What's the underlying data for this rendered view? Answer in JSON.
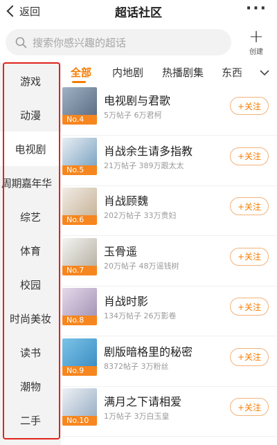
{
  "header": {
    "back_label": "返回",
    "title": "超话社区",
    "more_label": "···"
  },
  "search": {
    "placeholder": "搜索你感兴趣的超话",
    "create_label": "创建"
  },
  "sidebar": {
    "items": [
      {
        "label": "游戏"
      },
      {
        "label": "动漫"
      },
      {
        "label": "电视剧",
        "active": true
      },
      {
        "label": "周期嘉年华"
      },
      {
        "label": "综艺"
      },
      {
        "label": "体育"
      },
      {
        "label": "校园"
      },
      {
        "label": "时尚美妆"
      },
      {
        "label": "读书"
      },
      {
        "label": "潮物"
      },
      {
        "label": "二手"
      }
    ]
  },
  "tabs": [
    {
      "label": "全部",
      "active": true
    },
    {
      "label": "内地剧"
    },
    {
      "label": "热播剧集"
    },
    {
      "label": "东西"
    }
  ],
  "list": [
    {
      "name": "电视剧与君歌",
      "meta": "5万帖子 6万君柯",
      "rank": "No.4",
      "follow": "+关注",
      "colors": [
        "#9fb2c4",
        "#5d6f86"
      ]
    },
    {
      "name": "肖战余生请多指教",
      "meta": "21万帖子 389万跟太太",
      "rank": "No.5",
      "follow": "+关注",
      "colors": [
        "#e8eef3",
        "#7fa6c4"
      ]
    },
    {
      "name": "肖战顾魏",
      "meta": "202万帖子 33万贵妇",
      "rank": "No.6",
      "follow": "+关注",
      "colors": [
        "#f1ece6",
        "#c9b59a"
      ]
    },
    {
      "name": "玉骨遥",
      "meta": "20万帖子 48万谣钱树",
      "rank": "No.7",
      "follow": "+关注",
      "colors": [
        "#f4f4f2",
        "#b9b3a6"
      ]
    },
    {
      "name": "肖战时影",
      "meta": "134万帖子 26万影卷",
      "rank": "No.8",
      "follow": "+关注",
      "colors": [
        "#e6d9ea",
        "#a596b8"
      ]
    },
    {
      "name": "剧版暗格里的秘密",
      "meta": "8372帖子 3万粉丝",
      "rank": "No.9",
      "follow": "+关注",
      "colors": [
        "#7cc3e8",
        "#3d8fc4"
      ]
    },
    {
      "name": "满月之下请相爱",
      "meta": "1万帖子 3万白玉皇",
      "rank": "No.10",
      "follow": "+关注",
      "colors": [
        "#eef1f5",
        "#9bb0c6"
      ]
    }
  ],
  "accent_color": "#f57c00",
  "highlight_outline_color": "#e0231c"
}
